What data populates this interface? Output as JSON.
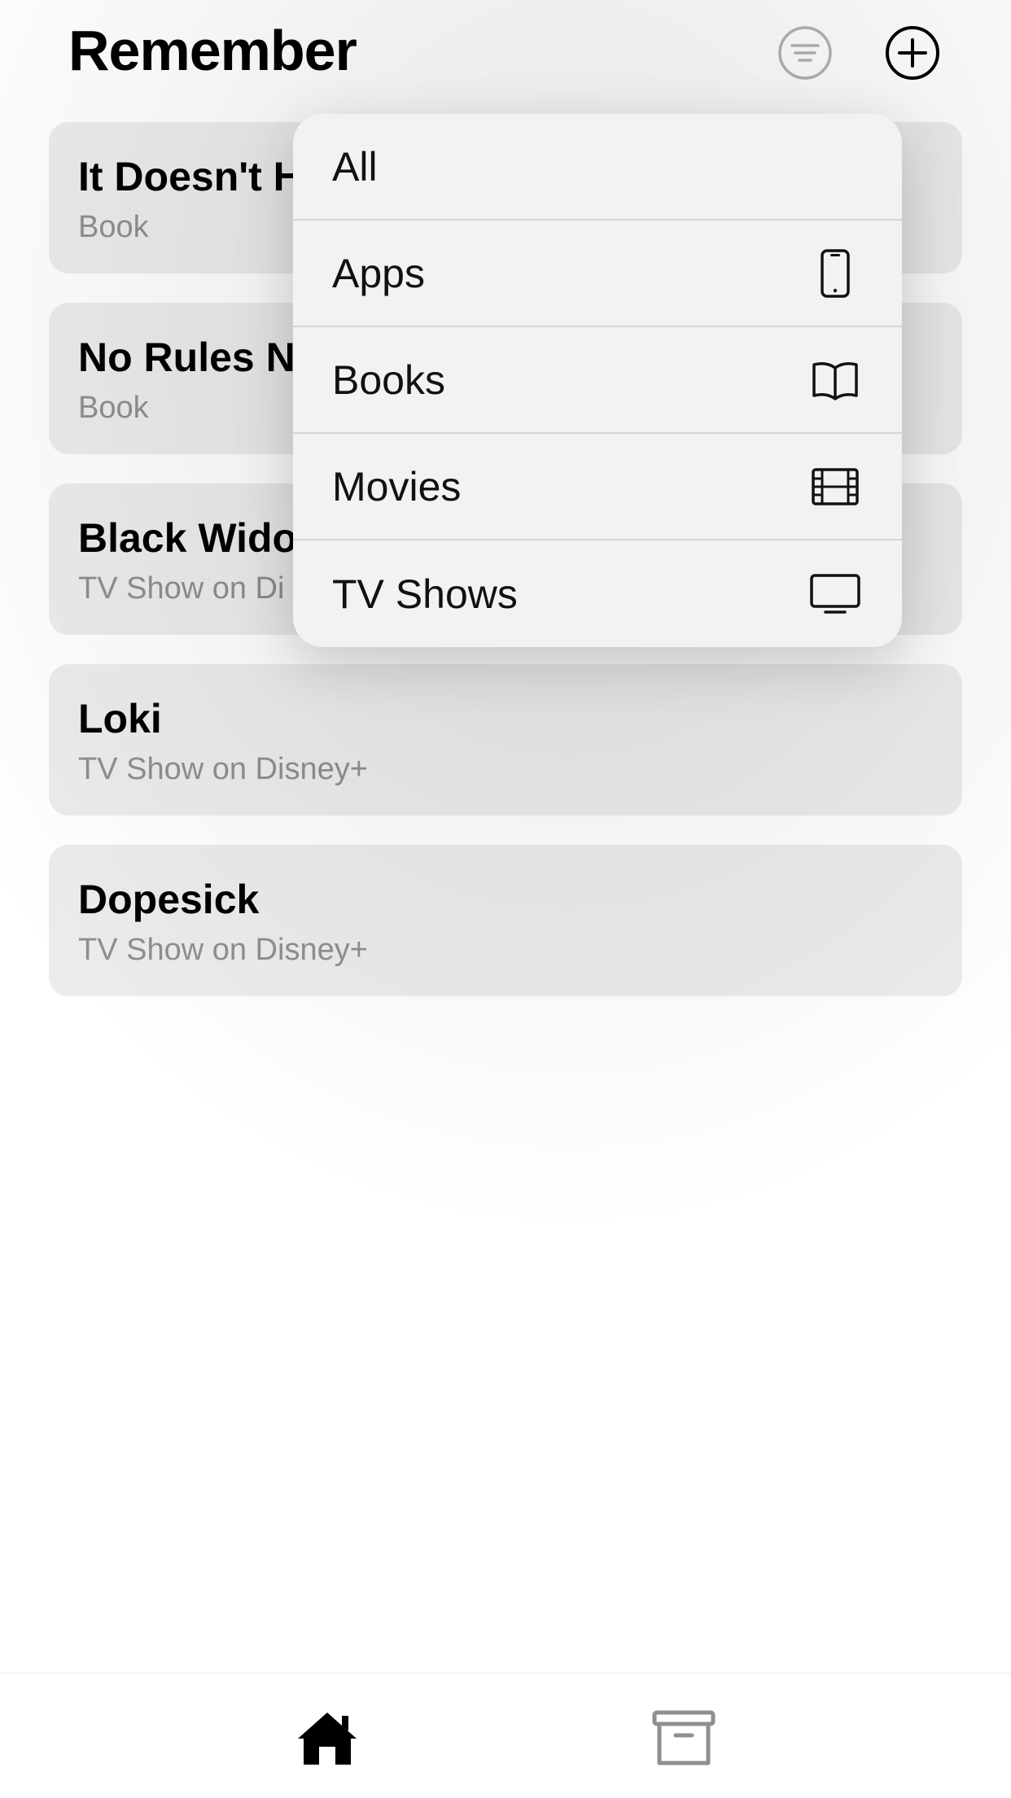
{
  "app": {
    "title": "Remember"
  },
  "header": {
    "filter_icon": "filter-circle-icon",
    "add_icon": "plus-circle-icon"
  },
  "items": [
    {
      "title": "It Doesn't H",
      "subtitle": "Book"
    },
    {
      "title": "No Rules No",
      "subtitle": "Book"
    },
    {
      "title": "Black Wido",
      "subtitle": "TV Show on Di"
    },
    {
      "title": "Loki",
      "subtitle": "TV Show on Disney+"
    },
    {
      "title": "Dopesick",
      "subtitle": "TV Show on Disney+"
    }
  ],
  "filter_menu": {
    "options": [
      {
        "label": "All",
        "icon": ""
      },
      {
        "label": "Apps",
        "icon": "phone-icon"
      },
      {
        "label": "Books",
        "icon": "book-icon"
      },
      {
        "label": "Movies",
        "icon": "film-icon"
      },
      {
        "label": "TV Shows",
        "icon": "tv-icon"
      }
    ]
  },
  "tabbar": {
    "tabs": [
      {
        "icon": "house-icon",
        "selected": true
      },
      {
        "icon": "archive-box-icon",
        "selected": false
      }
    ]
  },
  "colors": {
    "card_bg": "#ececec",
    "menu_bg": "#f2f2f4",
    "secondary_text": "#8e8e93"
  }
}
